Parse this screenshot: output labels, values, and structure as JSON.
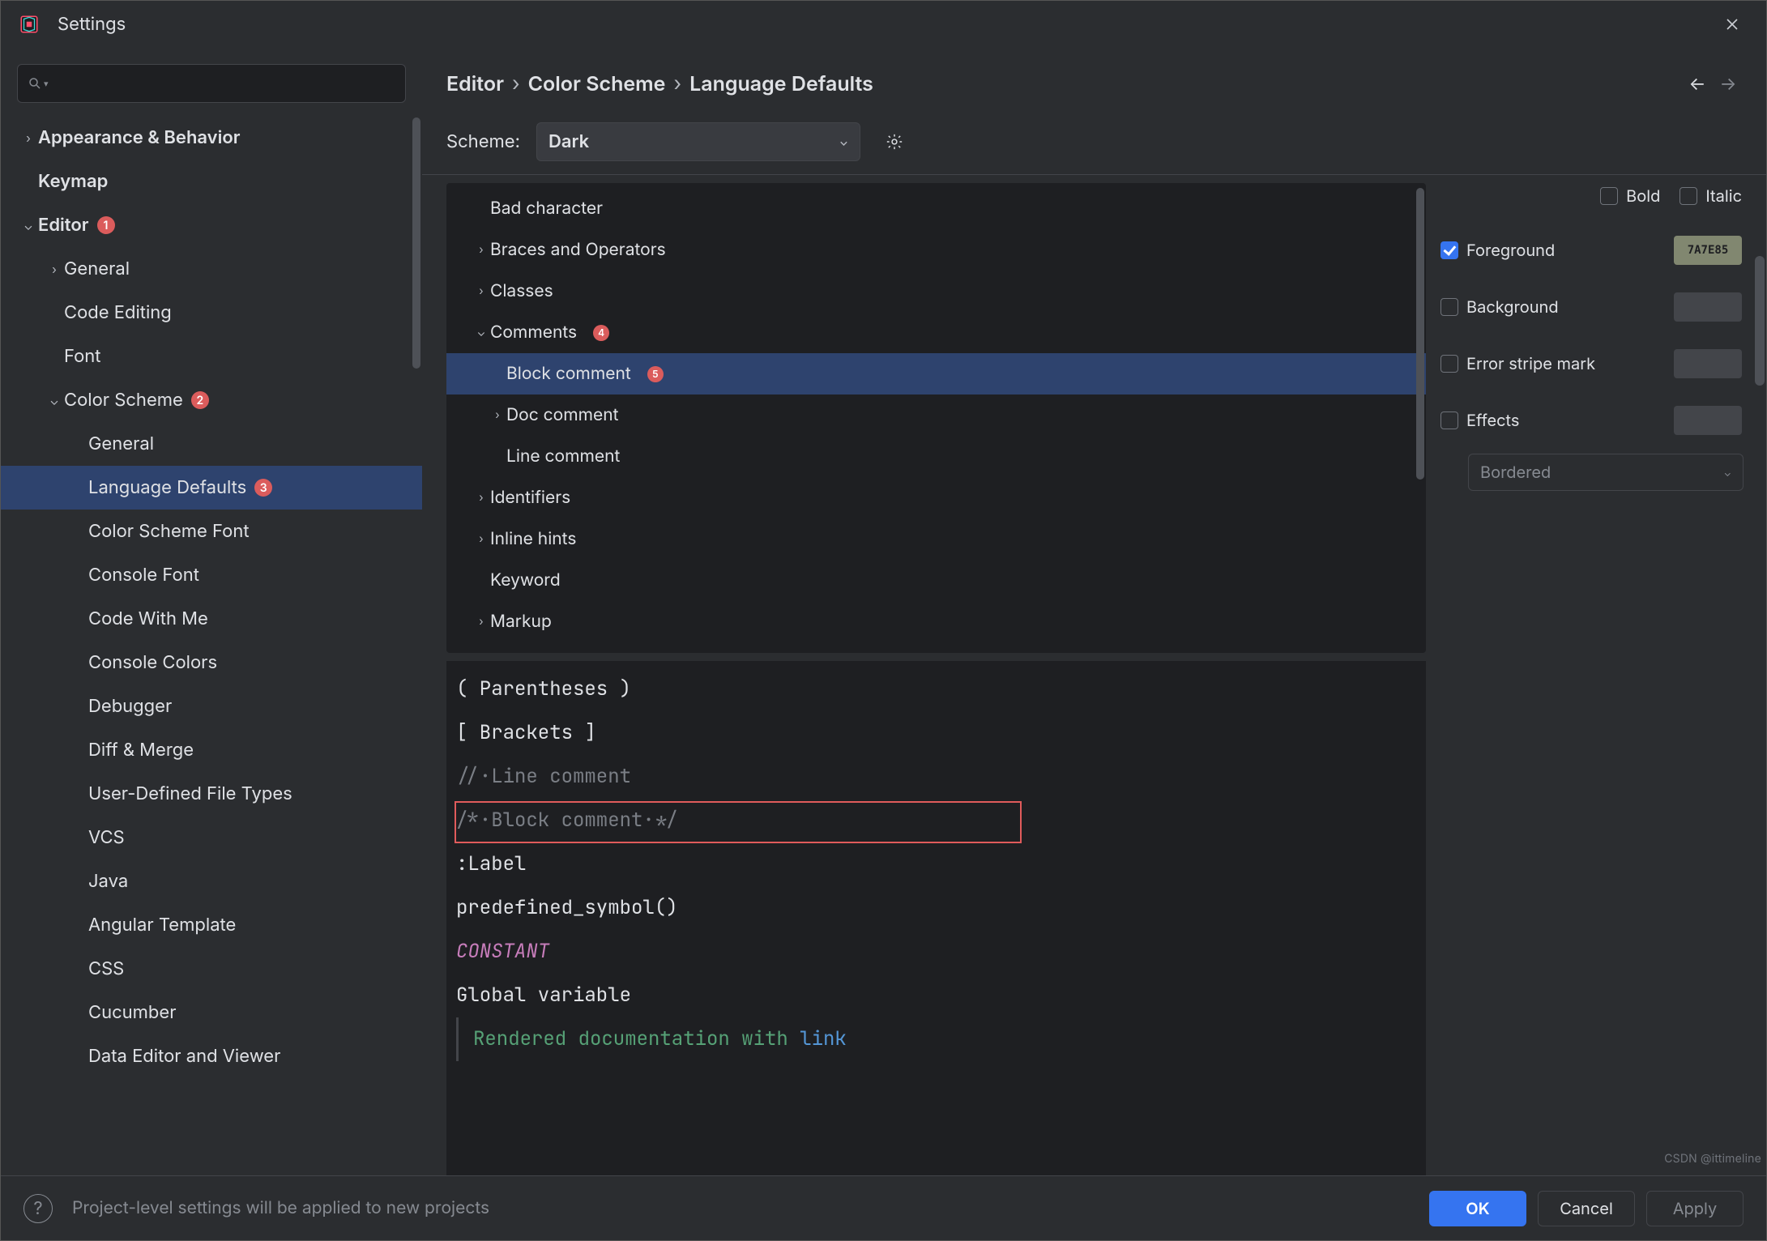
{
  "window": {
    "title": "Settings"
  },
  "search": {
    "placeholder": ""
  },
  "tree": [
    {
      "id": "appearance",
      "label": "Appearance & Behavior",
      "level": 0,
      "chev": "right",
      "bold": true
    },
    {
      "id": "keymap",
      "label": "Keymap",
      "level": 0,
      "chev": "none",
      "bold": true
    },
    {
      "id": "editor",
      "label": "Editor",
      "level": 0,
      "chev": "down",
      "bold": true,
      "badge": "1"
    },
    {
      "id": "general",
      "label": "General",
      "level": 1,
      "chev": "right"
    },
    {
      "id": "codeedit",
      "label": "Code Editing",
      "level": 1,
      "chev": "none"
    },
    {
      "id": "font",
      "label": "Font",
      "level": 1,
      "chev": "none"
    },
    {
      "id": "colorscheme",
      "label": "Color Scheme",
      "level": 1,
      "chev": "down",
      "badge": "2"
    },
    {
      "id": "cs-general",
      "label": "General",
      "level": 2,
      "chev": "none"
    },
    {
      "id": "cs-langdef",
      "label": "Language Defaults",
      "level": 2,
      "chev": "none",
      "badge": "3",
      "selected": true
    },
    {
      "id": "cs-font",
      "label": "Color Scheme Font",
      "level": 2,
      "chev": "none"
    },
    {
      "id": "cs-console",
      "label": "Console Font",
      "level": 2,
      "chev": "none"
    },
    {
      "id": "cs-cwm",
      "label": "Code With Me",
      "level": 2,
      "chev": "none"
    },
    {
      "id": "cs-concolors",
      "label": "Console Colors",
      "level": 2,
      "chev": "none"
    },
    {
      "id": "cs-debugger",
      "label": "Debugger",
      "level": 2,
      "chev": "none"
    },
    {
      "id": "cs-diff",
      "label": "Diff & Merge",
      "level": 2,
      "chev": "none"
    },
    {
      "id": "cs-udft",
      "label": "User-Defined File Types",
      "level": 2,
      "chev": "none"
    },
    {
      "id": "cs-vcs",
      "label": "VCS",
      "level": 2,
      "chev": "none"
    },
    {
      "id": "cs-java",
      "label": "Java",
      "level": 2,
      "chev": "none"
    },
    {
      "id": "cs-angular",
      "label": "Angular Template",
      "level": 2,
      "chev": "none"
    },
    {
      "id": "cs-css",
      "label": "CSS",
      "level": 2,
      "chev": "none"
    },
    {
      "id": "cs-cucumber",
      "label": "Cucumber",
      "level": 2,
      "chev": "none"
    },
    {
      "id": "cs-dataed",
      "label": "Data Editor and Viewer",
      "level": 2,
      "chev": "none"
    }
  ],
  "breadcrumbs": [
    "Editor",
    "Color Scheme",
    "Language Defaults"
  ],
  "scheme": {
    "label": "Scheme:",
    "selected": "Dark"
  },
  "attrTree": [
    {
      "id": "badchar",
      "label": "Bad character",
      "level": 0,
      "chev": "none"
    },
    {
      "id": "braces",
      "label": "Braces and Operators",
      "level": 0,
      "chev": "right"
    },
    {
      "id": "classes",
      "label": "Classes",
      "level": 0,
      "chev": "right"
    },
    {
      "id": "comments",
      "label": "Comments",
      "level": 0,
      "chev": "down",
      "badge": "4"
    },
    {
      "id": "blockc",
      "label": "Block comment",
      "level": 1,
      "chev": "none",
      "badge": "5",
      "selected": true
    },
    {
      "id": "docc",
      "label": "Doc comment",
      "level": 1,
      "chev": "right"
    },
    {
      "id": "linec",
      "label": "Line comment",
      "level": 1,
      "chev": "none"
    },
    {
      "id": "idents",
      "label": "Identifiers",
      "level": 0,
      "chev": "right"
    },
    {
      "id": "inlineh",
      "label": "Inline hints",
      "level": 0,
      "chev": "right"
    },
    {
      "id": "keyword",
      "label": "Keyword",
      "level": 0,
      "chev": "none"
    },
    {
      "id": "markup",
      "label": "Markup",
      "level": 0,
      "chev": "right"
    }
  ],
  "attrs": {
    "bold": {
      "label": "Bold",
      "checked": false
    },
    "italic": {
      "label": "Italic",
      "checked": false
    },
    "foreground": {
      "label": "Foreground",
      "checked": true,
      "swatch": "7A7E85"
    },
    "background": {
      "label": "Background",
      "checked": false
    },
    "errorstripe": {
      "label": "Error stripe mark",
      "checked": false
    },
    "effects": {
      "label": "Effects",
      "checked": false,
      "type": "Bordered"
    }
  },
  "preview": {
    "parens": "( Parentheses )",
    "brackets": "[ Brackets ]",
    "linecomment": "//·Line comment",
    "blockcomment": "/*·Block comment·*/",
    "label": ":Label",
    "predef": "predefined_symbol()",
    "constant": "CONSTANT",
    "global": "Global variable",
    "rendered_prefix": "Rendered documentation with ",
    "rendered_link": "link"
  },
  "footer": {
    "hint": "Project-level settings will be applied to new projects",
    "ok": "OK",
    "cancel": "Cancel",
    "apply": "Apply"
  },
  "watermark": "CSDN @ittimeline"
}
